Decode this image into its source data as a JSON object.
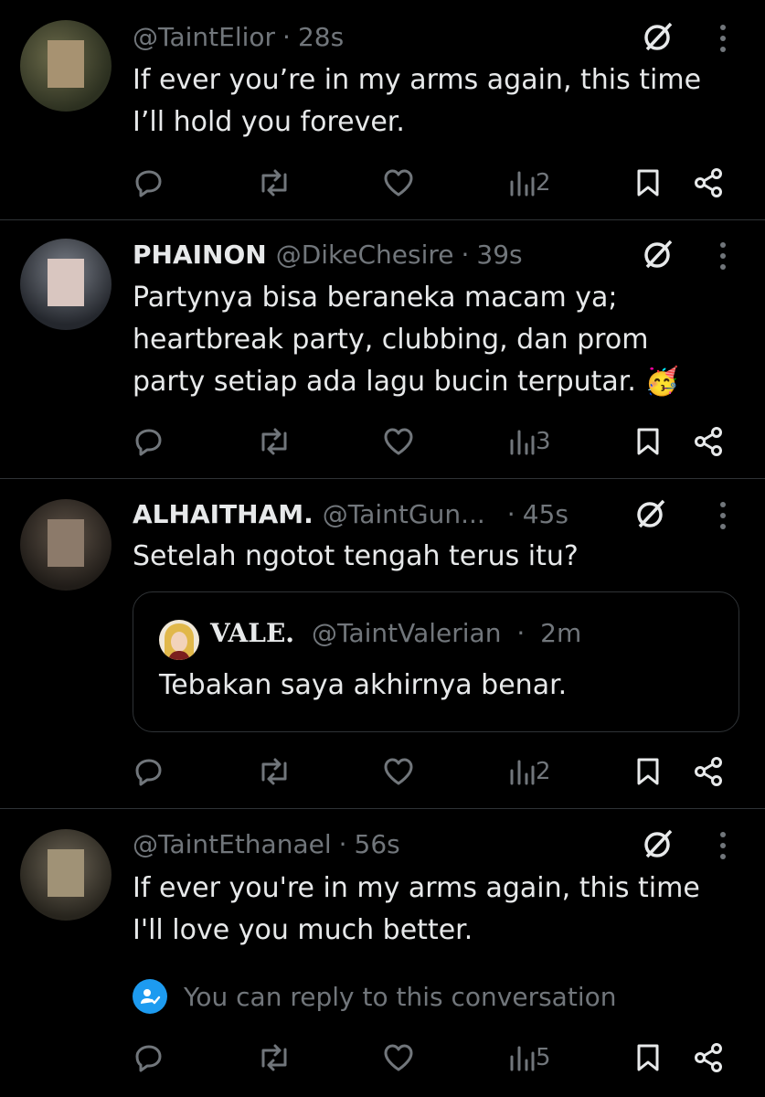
{
  "tweets": [
    {
      "name": "",
      "handle": "@TaintElior",
      "time": "28s",
      "lines": [
        "If ever you’re in my arms again, this time",
        "I’ll hold you forever."
      ],
      "views": "2"
    },
    {
      "name": "PHAINON",
      "handle": "@DikeChesire",
      "time": "39s",
      "lines": [
        "Partynya bisa beraneka macam ya;",
        "heartbreak party, clubbing, dan prom",
        "party setiap ada lagu bucin terputar. 🥳"
      ],
      "views": "3"
    },
    {
      "name": "ALHAITHAM.",
      "handle": "@TaintGun...",
      "time": "45s",
      "lines": [
        "Setelah ngotot tengah terus itu?"
      ],
      "views": "2",
      "quote": {
        "name": "VALE.",
        "handle": "@TaintValerian",
        "time": "2m",
        "text": "Tebakan saya akhirnya benar."
      }
    },
    {
      "name": "",
      "handle": "@TaintEthanael",
      "time": "56s",
      "lines": [
        "If ever you're in my arms again, this time",
        "I'll love you much better."
      ],
      "views": "5"
    }
  ],
  "reply_note": "You can reply to this conversation",
  "separator": "·",
  "colors": {
    "background": "#000000",
    "text": "#e7e9ea",
    "muted": "#71767b",
    "accent": "#1d9bf0",
    "border": "#2f3336"
  },
  "icons": [
    "reply-icon",
    "retweet-icon",
    "like-icon",
    "views-icon",
    "bookmark-icon",
    "share-icon",
    "grok-icon",
    "more-icon",
    "reply-permission-icon"
  ]
}
